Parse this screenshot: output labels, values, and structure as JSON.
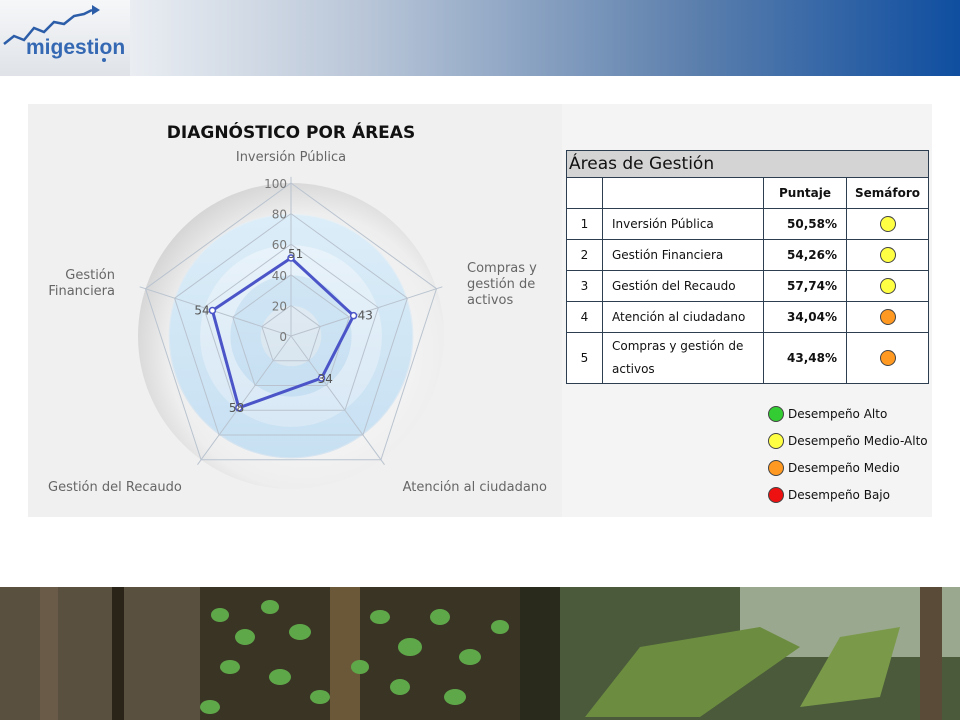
{
  "header": {
    "logo_text": "migestion"
  },
  "chart": {
    "title": "DIAGNÓSTICO POR ÁREAS"
  },
  "chart_data": {
    "type": "radar",
    "title": "DIAGNÓSTICO POR ÁREAS",
    "axes": [
      "Inversión Pública",
      "Compras y gestión de activos",
      "Atención al ciudadano",
      "Gestión del Recaudo",
      "Gestión Financiera"
    ],
    "axis_label_lines": [
      [
        "Inversión Pública"
      ],
      [
        "Compras y",
        "gestión de",
        "activos"
      ],
      [
        "Atención al ciudadano"
      ],
      [
        "Gestión del Recaudo"
      ],
      [
        "Gestión",
        "Financiera"
      ]
    ],
    "values": [
      51,
      43,
      34,
      58,
      54
    ],
    "ticks": [
      "0",
      "20",
      "40",
      "60",
      "80",
      "100"
    ],
    "rlim": [
      0,
      100
    ],
    "grid": true,
    "series_color": "#4b55c8"
  },
  "table": {
    "caption": "Áreas de Gestión",
    "headers": {
      "score": "Puntaje",
      "light": "Semáforo"
    },
    "rows": [
      {
        "num": "1",
        "name": "Inversión Pública",
        "score": "50,58%",
        "color": "#ffff44"
      },
      {
        "num": "2",
        "name": "Gestión Financiera",
        "score": "54,26%",
        "color": "#ffff44"
      },
      {
        "num": "3",
        "name": "Gestión del Recaudo",
        "score": "57,74%",
        "color": "#ffff44"
      },
      {
        "num": "4",
        "name": "Atención al ciudadano",
        "score": "34,04%",
        "color": "#ff9922"
      },
      {
        "num": "5",
        "name": "Compras y gestión de activos",
        "score": "43,48%",
        "color": "#ff9922"
      }
    ]
  },
  "legend": [
    {
      "label": "Desempeño Alto",
      "color": "#33cc33"
    },
    {
      "label": "Desempeño Medio-Alto",
      "color": "#ffff44"
    },
    {
      "label": "Desempeño Medio",
      "color": "#ff9922"
    },
    {
      "label": "Desempeño Bajo",
      "color": "#ee1111"
    }
  ]
}
